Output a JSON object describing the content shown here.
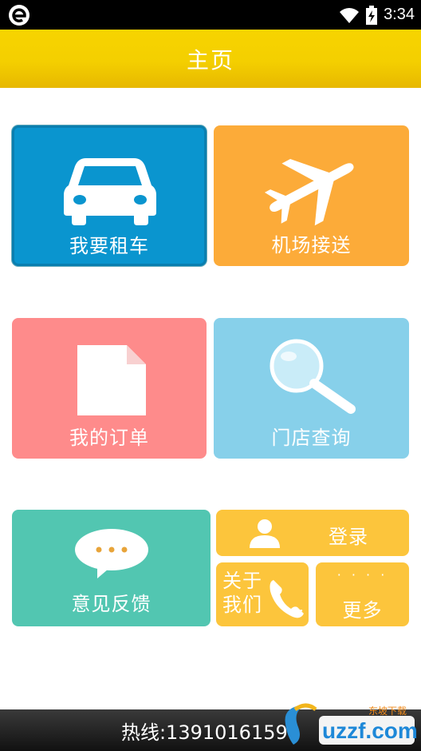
{
  "status_bar": {
    "time": "3:34"
  },
  "header": {
    "title": "主页"
  },
  "tiles": {
    "rent_car": "我要租车",
    "airport_transfer": "机场接送",
    "my_orders": "我的订单",
    "store_search": "门店查询",
    "feedback": "意见反馈",
    "login": "登录",
    "about_line1": "关于",
    "about_line2": "我们",
    "more": "更多"
  },
  "footer": {
    "hotline": "热线:13910161599"
  },
  "watermark": {
    "brand": "uzzf.com",
    "sub": "东坡下载"
  },
  "colors": {
    "header": "#f4cf00",
    "rent_car": "#0a95cf",
    "airport_transfer": "#fcab39",
    "my_orders": "#fe8b8b",
    "store_search": "#87d0ea",
    "feedback": "#52c6b1",
    "login": "#fcc53c"
  }
}
